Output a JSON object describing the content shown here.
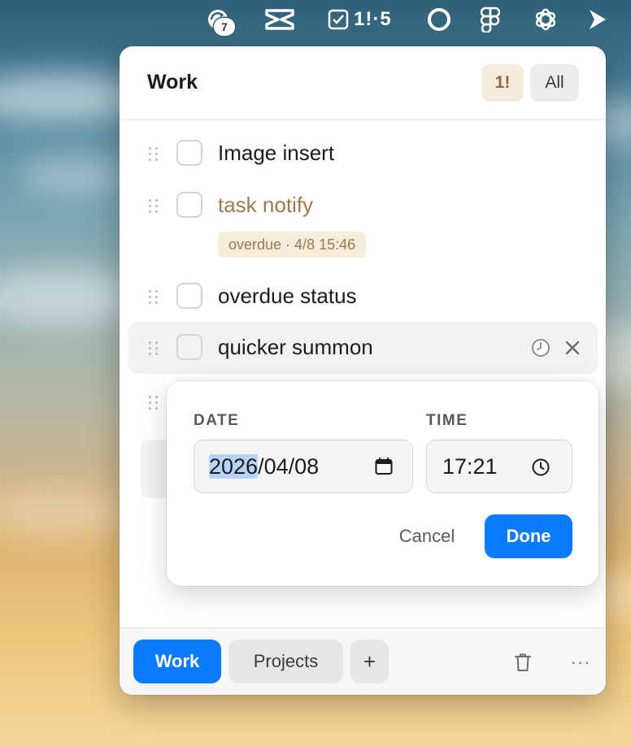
{
  "menubar": {
    "items": [
      {
        "icon": "cloud-sync-icon",
        "badge": "7"
      },
      {
        "icon": "capcut-icon"
      },
      {
        "icon": "checkbox-icon",
        "text": "1!·5"
      },
      {
        "icon": "circle-ring-icon"
      },
      {
        "icon": "figma-icon"
      },
      {
        "icon": "openai-icon"
      },
      {
        "icon": "play-arrow-icon"
      }
    ]
  },
  "panel": {
    "title": "Work",
    "filters": {
      "priority_label": "1!",
      "all_label": "All"
    },
    "tasks": [
      {
        "label": "Image insert",
        "overdue": false
      },
      {
        "label": "task notify",
        "overdue": true,
        "overdue_text": "overdue · 4/8 15:46"
      },
      {
        "label": "overdue status",
        "overdue": false
      },
      {
        "label": "quicker summon",
        "overdue": false,
        "hover": true
      }
    ],
    "footer": {
      "tabs": [
        {
          "label": "Work",
          "active": true
        },
        {
          "label": "Projects",
          "active": false
        }
      ],
      "add_label": "+",
      "more_label": "···"
    }
  },
  "datetime_popover": {
    "date_label": "DATE",
    "time_label": "TIME",
    "date_year": "2026",
    "date_rest": "/04/08",
    "time_value": "17:21",
    "cancel_label": "Cancel",
    "done_label": "Done"
  },
  "colors": {
    "accent": "#0a7aff",
    "overdue": "#9b7a4e",
    "overdue_bg": "#f5ecdc",
    "priority_bg": "#f4ebdd"
  }
}
